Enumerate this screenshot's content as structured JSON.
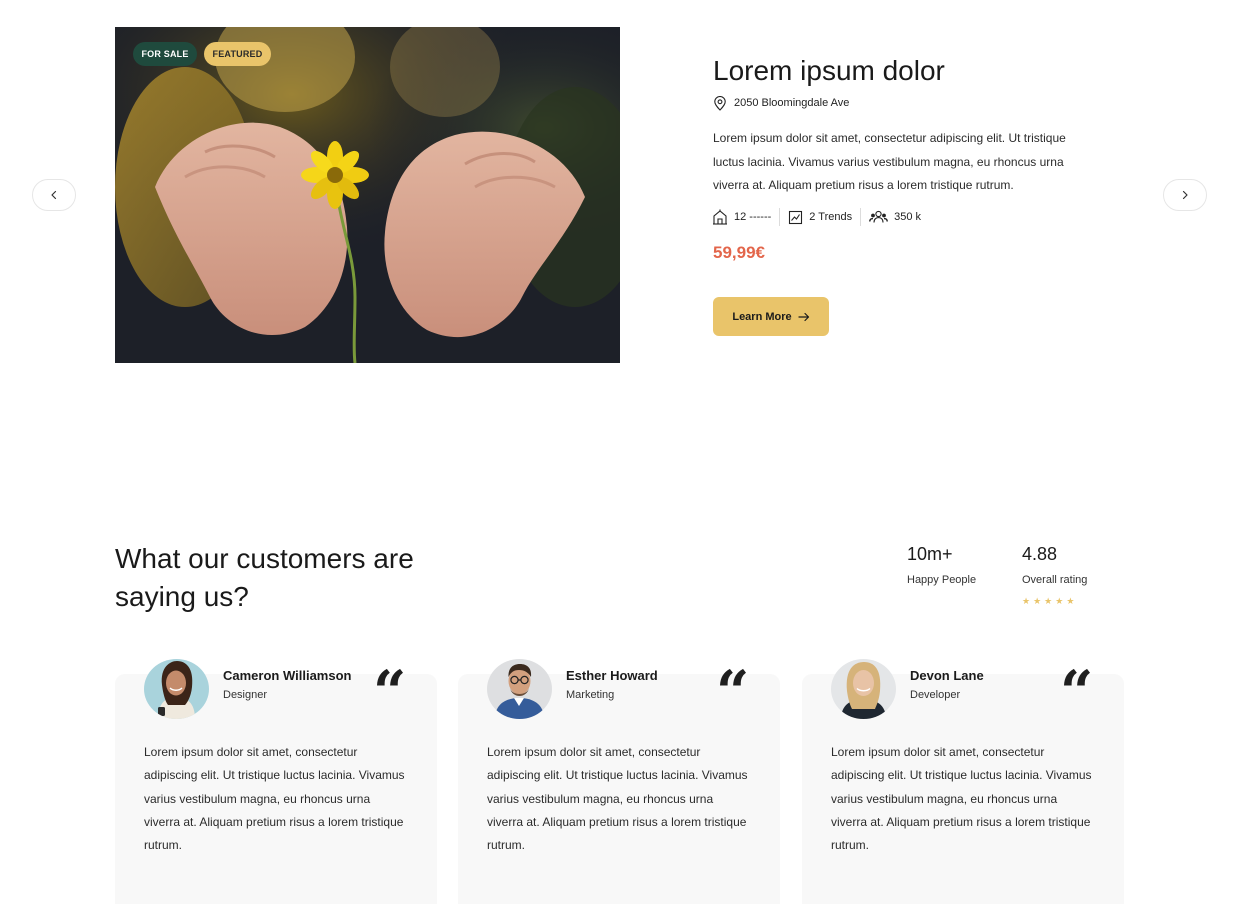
{
  "colors": {
    "accent_yellow": "#e9c46a",
    "dark_green": "#1f4a3d",
    "price_red": "#e3664b",
    "card_bg": "#f8f8f8"
  },
  "carousel": {
    "prev_icon": "chevron-left-icon",
    "next_icon": "chevron-right-icon"
  },
  "property": {
    "badges": {
      "sale": "FOR SALE",
      "featured": "FEATURED"
    },
    "title": "Lorem ipsum dolor",
    "address": "2050 Bloomingdale Ave",
    "description": "Lorem ipsum dolor sit amet, consectetur adipiscing elit. Ut tristique luctus lacinia. Vivamus varius vestibulum magna, eu rhoncus urna viverra at. Aliquam pretium risus a lorem tristique rutrum.",
    "stats": [
      {
        "icon": "building-icon",
        "label": "12 ------"
      },
      {
        "icon": "trend-chart-icon",
        "label": "2 Trends"
      },
      {
        "icon": "people-icon",
        "label": "350 k"
      }
    ],
    "price": "59,99€",
    "cta": "Learn More"
  },
  "testimonials": {
    "heading": "What our customers are saying us?",
    "metrics": [
      {
        "value": "10m+",
        "label": "Happy People"
      },
      {
        "value": "4.88",
        "label": "Overall rating"
      }
    ],
    "rating_stars": 5,
    "items": [
      {
        "name": "Cameron Williamson",
        "role": "Designer",
        "text": "Lorem ipsum dolor sit amet, consectetur adipiscing elit. Ut tristique luctus lacinia. Vivamus varius vestibulum magna, eu rhoncus urna viverra at. Aliquam pretium risus a lorem tristique rutrum."
      },
      {
        "name": "Esther Howard",
        "role": "Marketing",
        "text": "Lorem ipsum dolor sit amet, consectetur adipiscing elit. Ut tristique luctus lacinia. Vivamus varius vestibulum magna, eu rhoncus urna viverra at. Aliquam pretium risus a lorem tristique rutrum."
      },
      {
        "name": "Devon Lane",
        "role": "Developer",
        "text": "Lorem ipsum dolor sit amet, consectetur adipiscing elit. Ut tristique luctus lacinia. Vivamus varius vestibulum magna, eu rhoncus urna viverra at. Aliquam pretium risus a lorem tristique rutrum."
      }
    ],
    "quote_glyph": "“"
  }
}
